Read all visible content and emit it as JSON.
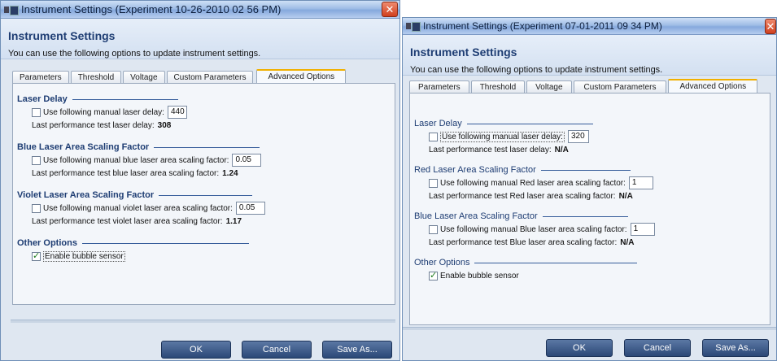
{
  "left_dialog": {
    "title": "Instrument Settings (Experiment 10-26-2010 02 56 PM)",
    "header_title": "Instrument Settings",
    "header_desc": "You can use the following options to update instrument settings.",
    "tabs": [
      "Parameters",
      "Threshold",
      "Voltage",
      "Custom Parameters",
      "Advanced Options"
    ],
    "active_tab": "Advanced Options",
    "sections": [
      {
        "title": "Laser Delay",
        "checkbox_label": "Use following manual laser delay:",
        "checked": false,
        "value": "440",
        "info_label": "Last performance test laser delay:",
        "info_value": "308"
      },
      {
        "title": "Blue Laser Area Scaling Factor",
        "checkbox_label": "Use following manual blue laser area scaling factor:",
        "checked": false,
        "value": "0.05",
        "info_label": "Last performance test blue laser area scaling factor:",
        "info_value": "1.24"
      },
      {
        "title": "Violet Laser Area Scaling Factor",
        "checkbox_label": "Use following manual violet laser area scaling factor:",
        "checked": false,
        "value": "0.05",
        "info_label": "Last performance test violet laser area scaling factor:",
        "info_value": "1.17"
      },
      {
        "title": "Other Options",
        "checkbox_label": "Enable bubble sensor",
        "checked": true
      }
    ],
    "buttons": {
      "ok": "OK",
      "cancel": "Cancel",
      "save_as": "Save As..."
    }
  },
  "right_dialog": {
    "title": "Instrument Settings (Experiment 07-01-2011 09 34 PM)",
    "header_title": "Instrument Settings",
    "header_desc": "You can use the following options to update instrument settings.",
    "tabs": [
      "Parameters",
      "Threshold",
      "Voltage",
      "Custom Parameters",
      "Advanced Options"
    ],
    "active_tab": "Advanced Options",
    "sections": [
      {
        "title": "Laser Delay",
        "checkbox_label": "Use following manual laser delay:",
        "checked": false,
        "value": "320",
        "info_label": "Last performance test laser delay:",
        "info_value": "N/A"
      },
      {
        "title": "Red Laser Area Scaling Factor",
        "checkbox_label": "Use following manual Red laser area scaling factor:",
        "checked": false,
        "value": "1",
        "info_label": "Last performance test Red laser area scaling factor:",
        "info_value": "N/A"
      },
      {
        "title": "Blue Laser Area Scaling Factor",
        "checkbox_label": "Use following manual Blue laser area scaling factor:",
        "checked": false,
        "value": "1",
        "info_label": "Last performance test Blue laser area scaling factor:",
        "info_value": "N/A"
      },
      {
        "title": "Other Options",
        "checkbox_label": "Enable bubble sensor",
        "checked": true
      }
    ],
    "buttons": {
      "ok": "OK",
      "cancel": "Cancel",
      "save_as": "Save As..."
    }
  },
  "icons": {
    "window": "app-window-icon",
    "close": "close-icon",
    "checkbox": "checkbox-icon"
  },
  "colors": {
    "accent": "#1e3d73",
    "close": "#d0401f",
    "tab_highlight": "#f0b000",
    "button": "#2b4877"
  }
}
